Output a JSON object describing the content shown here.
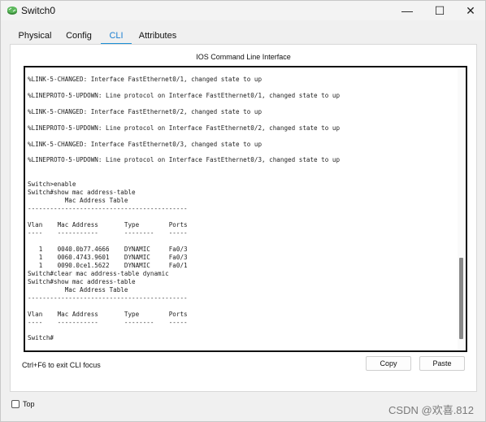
{
  "window": {
    "title": "Switch0",
    "minimize_glyph": "—",
    "maximize_glyph": "☐",
    "close_glyph": "✕"
  },
  "tabs": [
    {
      "label": "Physical",
      "active": false
    },
    {
      "label": "Config",
      "active": false
    },
    {
      "label": "CLI",
      "active": true
    },
    {
      "label": "Attributes",
      "active": false
    }
  ],
  "cli": {
    "header": "IOS Command Line Interface",
    "output": "\n%LINK-5-CHANGED: Interface FastEthernet0/1, changed state to up\n\n%LINEPROTO-5-UPDOWN: Line protocol on Interface FastEthernet0/1, changed state to up\n\n%LINK-5-CHANGED: Interface FastEthernet0/2, changed state to up\n\n%LINEPROTO-5-UPDOWN: Line protocol on Interface FastEthernet0/2, changed state to up\n\n%LINK-5-CHANGED: Interface FastEthernet0/3, changed state to up\n\n%LINEPROTO-5-UPDOWN: Line protocol on Interface FastEthernet0/3, changed state to up\n\n\nSwitch>enable\nSwitch#show mac address-table\n          Mac Address Table\n-------------------------------------------\n\nVlan    Mac Address       Type        Ports\n----    -----------       --------    -----\n\n   1    0040.0b77.4666    DYNAMIC     Fa0/3\n   1    0060.4743.9601    DYNAMIC     Fa0/3\n   1    0090.0ce1.5622    DYNAMIC     Fa0/1\nSwitch#clear mac address-table dynamic\nSwitch#show mac address-table\n          Mac Address Table\n-------------------------------------------\n\nVlan    Mac Address       Type        Ports\n----    -----------       --------    -----\n\nSwitch#",
    "hint": "Ctrl+F6 to exit CLI focus",
    "copy_label": "Copy",
    "paste_label": "Paste"
  },
  "footer": {
    "top_label": "Top",
    "top_checked": false,
    "watermark": "CSDN @欢喜.812"
  },
  "colors": {
    "accent": "#1b8fd6",
    "terminal_border": "#111111"
  },
  "icons": {
    "app": "packet-tracer-switch-icon"
  }
}
